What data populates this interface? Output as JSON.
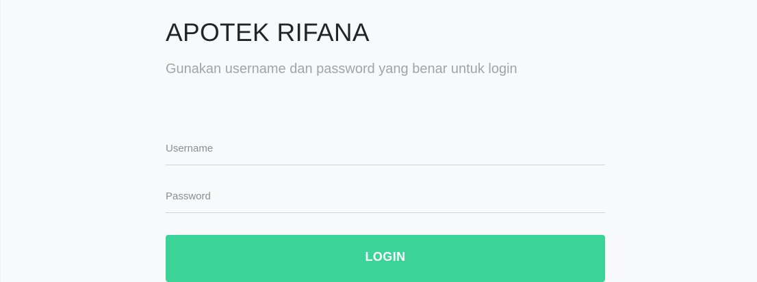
{
  "login": {
    "title": "APOTEK RIFANA",
    "subtitle": "Gunakan username dan password yang benar untuk login",
    "username": {
      "placeholder": "Username",
      "value": ""
    },
    "password": {
      "placeholder": "Password",
      "value": ""
    },
    "button_label": "LOGIN"
  },
  "colors": {
    "background": "#f8f9fa",
    "title": "#212529",
    "subtitle": "#a0a4a8",
    "button": "#3cd399",
    "button_text": "#ffffff"
  }
}
